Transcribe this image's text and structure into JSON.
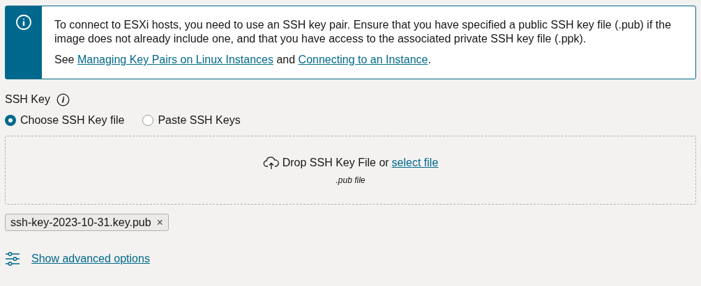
{
  "notice": {
    "message": "To connect to ESXi hosts, you need to use an SSH key pair. Ensure that you have specified a public SSH key file (.pub) if the image does not already include one, and that you have access to the associated private SSH key file (.ppk).",
    "see_parts": [
      {
        "kind": "text",
        "text": "See"
      },
      {
        "kind": "link",
        "text": "Managing Key Pairs on Linux Instances"
      },
      {
        "kind": "text",
        "text": "and"
      },
      {
        "kind": "link",
        "text": "Connecting to an Instance"
      },
      {
        "kind": "end",
        "text": "."
      }
    ]
  },
  "ssh_key": {
    "label": "SSH Key",
    "options": [
      {
        "label": "Choose SSH Key file",
        "selected": true
      },
      {
        "label": "Paste SSH Keys",
        "selected": false
      }
    ],
    "dropzone": {
      "text": "Drop SSH Key File or",
      "link": "select file",
      "hint": ".pub file"
    },
    "files": [
      {
        "name": "ssh-key-2023-10-31.key.pub",
        "remove": "×"
      }
    ]
  },
  "advanced_link": "Show advanced options"
}
